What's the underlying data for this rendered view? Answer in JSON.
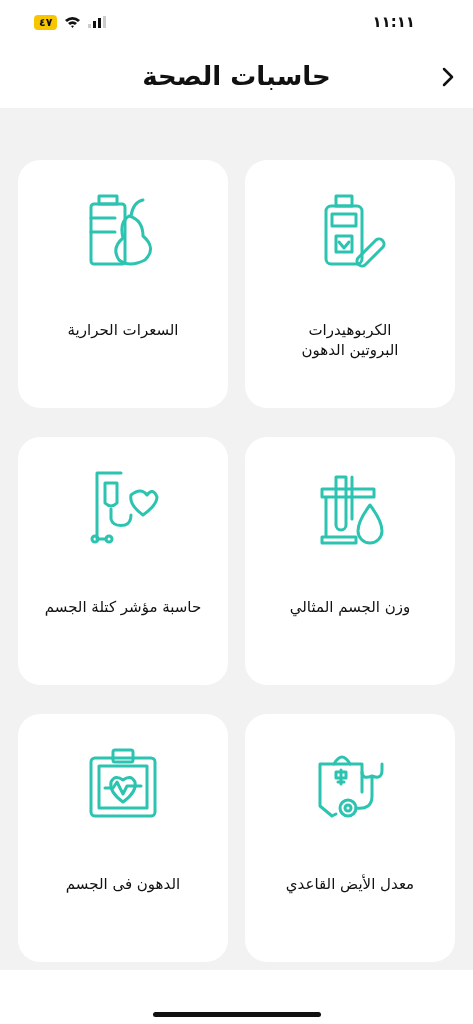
{
  "status_bar": {
    "time": "١١:١١",
    "battery": "٤٧"
  },
  "header": {
    "title": "حاسبات الصحة"
  },
  "cards": [
    {
      "kind": "supplement",
      "label": "الكربوهيدرات\nالبروتين الدهون"
    },
    {
      "kind": "food",
      "label": "السعرات الحرارية"
    },
    {
      "kind": "tubes",
      "label": "وزن الجسم المثالي"
    },
    {
      "kind": "drip",
      "label": "حاسبة مؤشر كتلة الجسم"
    },
    {
      "kind": "medkit",
      "label": "معدل الأيض القاعدي"
    },
    {
      "kind": "clipboard",
      "label": "الدهون فى الجسم"
    }
  ]
}
